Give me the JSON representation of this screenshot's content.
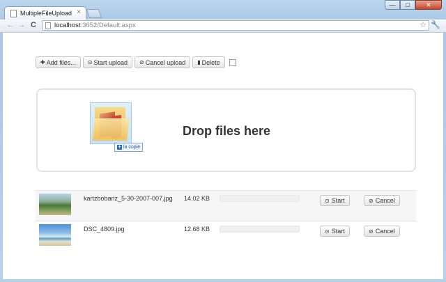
{
  "browser": {
    "tab_title": "MultipleFileUpload",
    "tab_close": "×",
    "url_host": "localhost",
    "url_rest": ":3652/Default.aspx",
    "window_buttons": {
      "minimize": "—",
      "maximize": "□",
      "close": "✕"
    },
    "nav": {
      "back": "←",
      "forward": "→",
      "reload": "C"
    },
    "star": "☆",
    "wrench": "🔧"
  },
  "toolbar": {
    "add_label": "Add files...",
    "start_label": "Start upload",
    "cancel_label": "Cancel upload",
    "delete_label": "Delete",
    "icons": {
      "add": "plus-icon",
      "start": "circle-arrow-up-icon",
      "cancel": "ban-icon",
      "delete": "trash-icon"
    }
  },
  "dropzone": {
    "text": "Drop files here",
    "copy_badge": "la copie"
  },
  "files": [
    {
      "name": "kartzbobariz_5-30-2007-007.jpg",
      "size": "14.02 KB",
      "progress": 0,
      "start_label": "Start",
      "cancel_label": "Cancel"
    },
    {
      "name": "DSC_4809.jpg",
      "size": "12.68 KB",
      "progress": 0,
      "start_label": "Start",
      "cancel_label": "Cancel"
    }
  ],
  "colors": {
    "window_frame": "#b7d0ea",
    "progress_fill": "#5aa55a",
    "close_button": "#c4472c"
  }
}
